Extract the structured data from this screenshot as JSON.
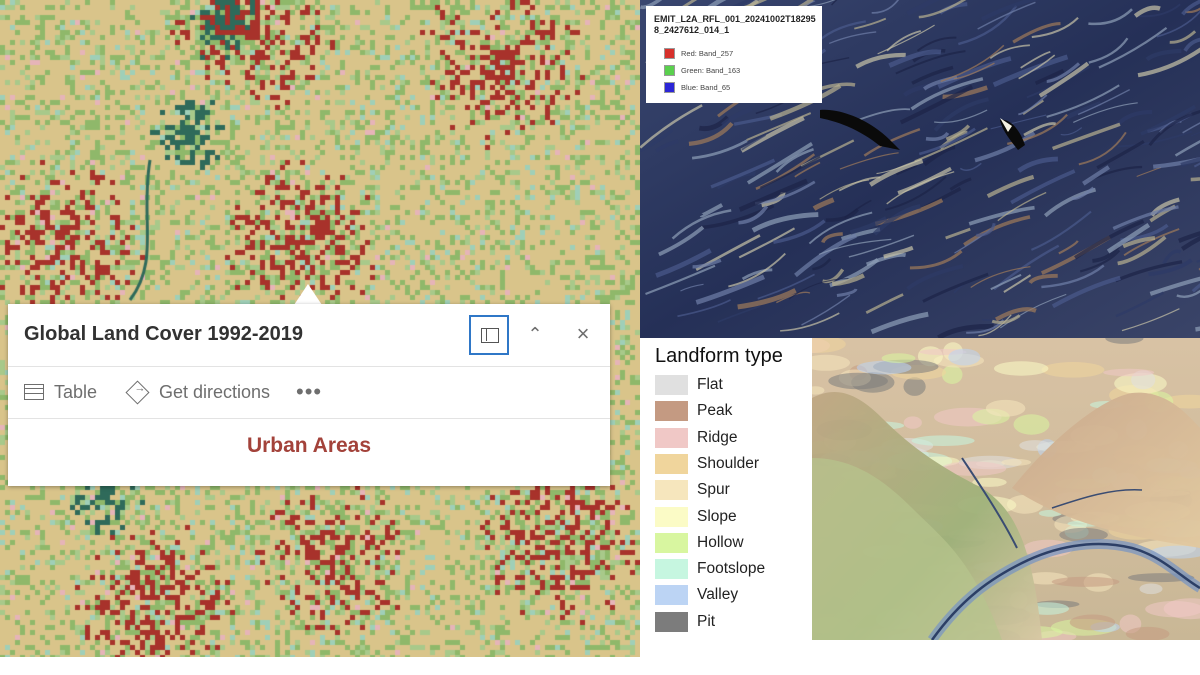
{
  "popup": {
    "title": "Global Land Cover 1992-2019",
    "actions": {
      "table": "Table",
      "directions": "Get directions",
      "more": "•••"
    },
    "collapse_glyph": "⌃",
    "close_glyph": "×",
    "feature_name": "Urban Areas"
  },
  "emit": {
    "title": "EMIT_L2A_RFL_001_20241002T182958_2427612_014_1",
    "bands": [
      {
        "label": "Red: Band_257",
        "color": "#d7302b"
      },
      {
        "label": "Green: Band_163",
        "color": "#5ad04e"
      },
      {
        "label": "Blue: Band_65",
        "color": "#2b25d6"
      }
    ]
  },
  "landform": {
    "title": "Landform type",
    "types": [
      {
        "label": "Flat",
        "color": "#e0e0e0"
      },
      {
        "label": "Peak",
        "color": "#c49a82"
      },
      {
        "label": "Ridge",
        "color": "#f0c8c6"
      },
      {
        "label": "Shoulder",
        "color": "#f0d59c"
      },
      {
        "label": "Spur",
        "color": "#f6e6bd"
      },
      {
        "label": "Slope",
        "color": "#fbfbc6"
      },
      {
        "label": "Hollow",
        "color": "#d8f6a0"
      },
      {
        "label": "Footslope",
        "color": "#c6f6e0"
      },
      {
        "label": "Valley",
        "color": "#bcd4f4"
      },
      {
        "label": "Pit",
        "color": "#7c7c7c"
      }
    ]
  },
  "landcover_colors": {
    "cropland": "#d9c48a",
    "grassland": "#8fb86a",
    "mosaic": "#a8c98a",
    "urban": "#a8322b",
    "forest": "#2f6a5a",
    "sparse": "#9fcfb8",
    "bare": "#e6b4b8"
  },
  "icons": {
    "table": "table-icon",
    "directions": "directions-icon",
    "dock": "dock-icon",
    "collapse": "chevron-up-icon",
    "close": "close-icon"
  }
}
